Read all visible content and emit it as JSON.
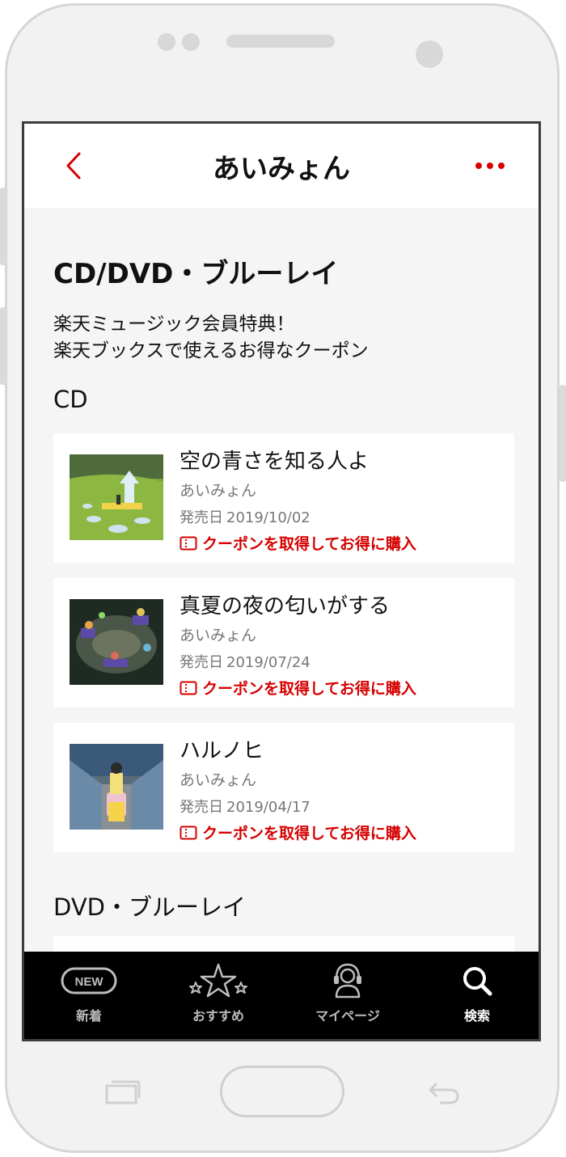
{
  "header": {
    "title": "あいみょん"
  },
  "section": {
    "title": "CD/DVD・ブルーレイ",
    "promo_line1": "楽天ミュージック会員特典！",
    "promo_line2": "楽天ブックスで使えるお得なクーポン",
    "cd_heading": "CD",
    "dvd_heading": "DVD・ブルーレイ"
  },
  "release_label": "発売日",
  "coupon_label": "クーポンを取得してお得に購入",
  "cds": [
    {
      "title": "空の青さを知る人よ",
      "artist": "あいみょん",
      "date": "2019/10/02"
    },
    {
      "title": "真夏の夜の匂いがする",
      "artist": "あいみょん",
      "date": "2019/07/24"
    },
    {
      "title": "ハルノヒ",
      "artist": "あいみょん",
      "date": "2019/04/17"
    }
  ],
  "tabbar": {
    "tabs": [
      {
        "label": "新着",
        "icon": "new-badge-icon",
        "badge": "NEW"
      },
      {
        "label": "おすすめ",
        "icon": "stars-icon"
      },
      {
        "label": "マイページ",
        "icon": "person-headphones-icon"
      },
      {
        "label": "検索",
        "icon": "search-icon"
      }
    ]
  },
  "colors": {
    "accent": "#d60000",
    "tabbar_bg": "#000000",
    "page_bg": "#f5f5f5"
  }
}
